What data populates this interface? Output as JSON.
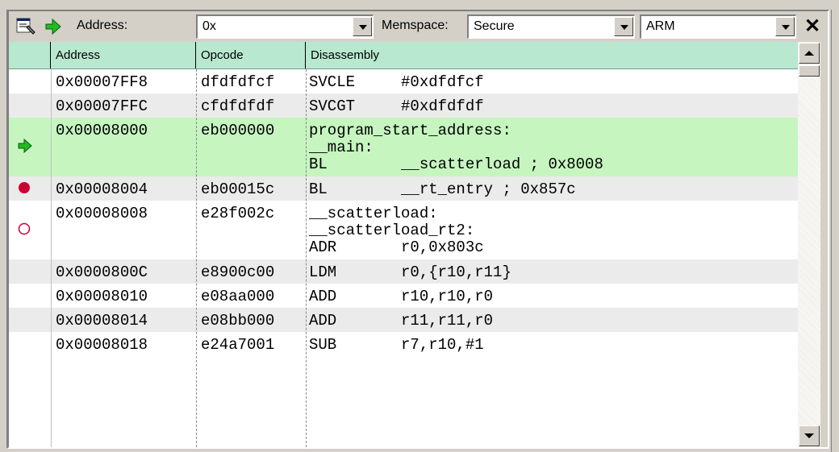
{
  "toolbar": {
    "address_label": "Address:",
    "address_value": "0x",
    "memspace_label": "Memspace:",
    "memspace_value": "Secure",
    "mode_value": "ARM",
    "close_glyph": "✕"
  },
  "columns": {
    "address": "Address",
    "opcode": "Opcode",
    "disassembly": "Disassembly"
  },
  "rows": [
    {
      "address": "0x00007FF8",
      "opcode": "dfdfdfcf",
      "lines": [
        "SVCLE     #0xdfdfcf"
      ],
      "marker": "",
      "bg": "#ffffff"
    },
    {
      "address": "0x00007FFC",
      "opcode": "cfdfdfdf",
      "lines": [
        "SVCGT     #0xdfdfdf"
      ],
      "marker": "",
      "bg": "#ebebeb"
    },
    {
      "address": "0x00008000",
      "opcode": "eb000000",
      "lines": [
        "program_start_address:",
        "__main:",
        "BL        __scatterload ; 0x8008"
      ],
      "marker": "current-pc-arrow-icon",
      "bg": "#c6f5c0"
    },
    {
      "address": "0x00008004",
      "opcode": "eb00015c",
      "lines": [
        "BL        __rt_entry ; 0x857c"
      ],
      "marker": "breakpoint-icon",
      "bg": "#ebebeb"
    },
    {
      "address": "0x00008008",
      "opcode": "e28f002c",
      "lines": [
        "__scatterload:",
        "__scatterload_rt2:",
        "ADR       r0,0x803c"
      ],
      "marker": "disabled-breakpoint-icon",
      "bg": "#ffffff"
    },
    {
      "address": "0x0000800C",
      "opcode": "e8900c00",
      "lines": [
        "LDM       r0,{r10,r11}"
      ],
      "marker": "",
      "bg": "#ebebeb"
    },
    {
      "address": "0x00008010",
      "opcode": "e08aa000",
      "lines": [
        "ADD       r10,r10,r0"
      ],
      "marker": "",
      "bg": "#ffffff"
    },
    {
      "address": "0x00008014",
      "opcode": "e08bb000",
      "lines": [
        "ADD       r11,r11,r0"
      ],
      "marker": "",
      "bg": "#ebebeb"
    },
    {
      "address": "0x00008018",
      "opcode": "e24a7001",
      "lines": [
        "SUB       r7,r10,#1"
      ],
      "marker": "",
      "bg": "#ffffff"
    }
  ]
}
